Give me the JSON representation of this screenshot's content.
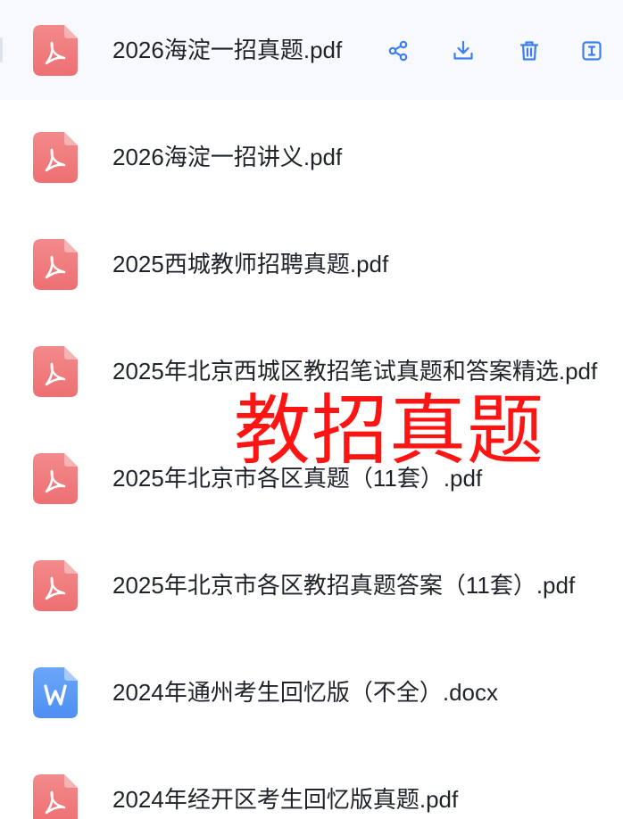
{
  "file_list": {
    "files": [
      {
        "name": "2026海淀一招真题.pdf",
        "type": "pdf",
        "icon": "pdf-icon",
        "active": true
      },
      {
        "name": "2026海淀一招讲义.pdf",
        "type": "pdf",
        "icon": "pdf-icon"
      },
      {
        "name": "2025西城教师招聘真题.pdf",
        "type": "pdf",
        "icon": "pdf-icon"
      },
      {
        "name": "2025年北京西城区教招笔试真题和答案精选.pdf",
        "type": "pdf",
        "icon": "pdf-icon"
      },
      {
        "name": "2025年北京市各区真题（11套）.pdf",
        "type": "pdf",
        "icon": "pdf-icon"
      },
      {
        "name": "2025年北京市各区教招真题答案（11套）.pdf",
        "type": "pdf",
        "icon": "pdf-icon"
      },
      {
        "name": "2024年通州考生回忆版（不全）.docx",
        "type": "docx",
        "icon": "word-icon"
      },
      {
        "name": "2024年经开区考生回忆版真题.pdf",
        "type": "pdf",
        "icon": "pdf-icon"
      }
    ],
    "row_actions": [
      {
        "name": "share",
        "icon": "share-icon"
      },
      {
        "name": "download",
        "icon": "download-icon"
      },
      {
        "name": "delete",
        "icon": "trash-icon"
      },
      {
        "name": "rename",
        "icon": "rename-icon"
      }
    ]
  },
  "overlay": {
    "watermark_text": "教招真题"
  },
  "colors": {
    "pdf_icon": "#f07b7d",
    "word_icon": "#5f9cf6",
    "action_icon": "#3c7ef0",
    "watermark": "#ff1414",
    "active_row_bg": "#f7f9fc",
    "file_name_text": "#1f2329"
  }
}
